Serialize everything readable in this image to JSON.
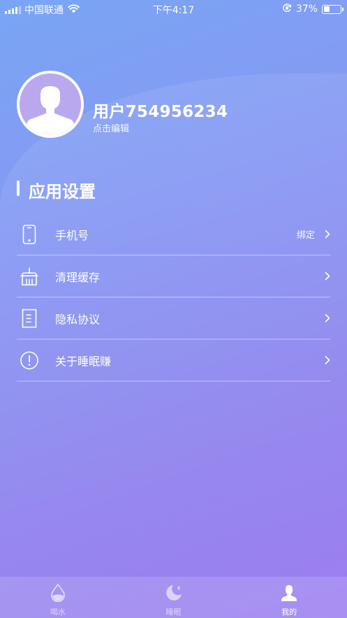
{
  "status_bar": {
    "carrier": "中国联通",
    "time": "下午4:17",
    "battery_percent": "37%",
    "battery_level": 0.37
  },
  "profile": {
    "username": "用户754956234",
    "edit_hint": "点击编辑"
  },
  "section": {
    "title": "应用设置"
  },
  "settings": [
    {
      "label": "手机号",
      "value": "绑定",
      "icon": "phone-icon"
    },
    {
      "label": "清理缓存",
      "value": "",
      "icon": "basket-icon"
    },
    {
      "label": "隐私协议",
      "value": "",
      "icon": "document-icon"
    },
    {
      "label": "关于睡眠赚",
      "value": "",
      "icon": "info-icon"
    }
  ],
  "tabs": [
    {
      "label": "喝水",
      "icon": "water-drop-icon",
      "active": false
    },
    {
      "label": "睡眠",
      "icon": "moon-icon",
      "active": false
    },
    {
      "label": "我的",
      "icon": "user-icon",
      "active": true
    }
  ],
  "colors": {
    "gradient_top": "#79a5f5",
    "gradient_bottom": "#9b7df0",
    "avatar_bg": "#b9a8ee"
  }
}
